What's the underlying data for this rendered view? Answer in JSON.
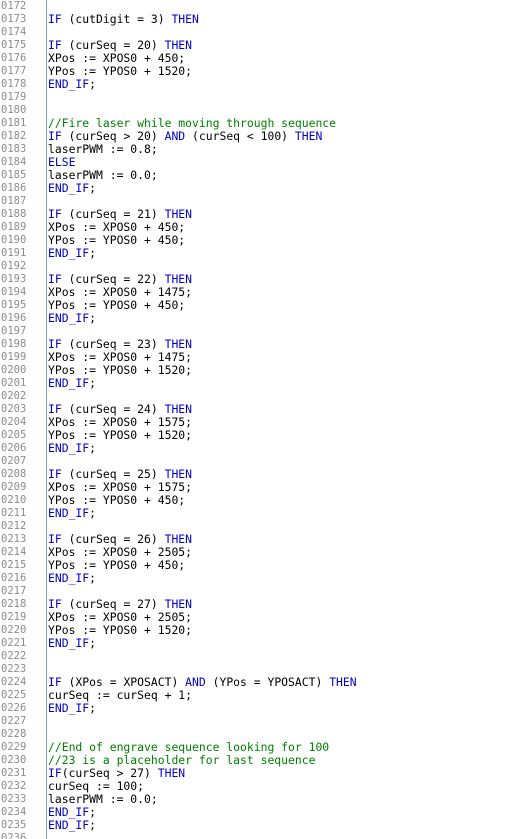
{
  "colors": {
    "keyword": "#0000c8",
    "comment": "#008000",
    "text": "#000000",
    "line_number": "#8c8c8c",
    "gutter_border": "#7f9db9"
  },
  "lines": [
    {
      "n": "0172",
      "t": [
        {
          "s": "",
          "c": "p"
        }
      ]
    },
    {
      "n": "0173",
      "t": [
        {
          "s": "IF",
          "c": "k"
        },
        {
          "s": " (cutDigit = 3) ",
          "c": "p"
        },
        {
          "s": "THEN",
          "c": "k"
        }
      ]
    },
    {
      "n": "0174",
      "t": [
        {
          "s": "",
          "c": "p"
        }
      ]
    },
    {
      "n": "0175",
      "t": [
        {
          "s": "IF",
          "c": "k"
        },
        {
          "s": " (curSeq = 20) ",
          "c": "p"
        },
        {
          "s": "THEN",
          "c": "k"
        }
      ]
    },
    {
      "n": "0176",
      "t": [
        {
          "s": "XPos := XPOS0 + 450;",
          "c": "p"
        }
      ]
    },
    {
      "n": "0177",
      "t": [
        {
          "s": "YPos := YPOS0 + 1520;",
          "c": "p"
        }
      ]
    },
    {
      "n": "0178",
      "t": [
        {
          "s": "END_IF",
          "c": "k"
        },
        {
          "s": ";",
          "c": "p"
        }
      ]
    },
    {
      "n": "0179",
      "t": [
        {
          "s": "",
          "c": "p"
        }
      ]
    },
    {
      "n": "0180",
      "t": [
        {
          "s": "",
          "c": "p"
        }
      ]
    },
    {
      "n": "0181",
      "t": [
        {
          "s": "//Fire laser while moving through sequence",
          "c": "c"
        }
      ]
    },
    {
      "n": "0182",
      "t": [
        {
          "s": "IF",
          "c": "k"
        },
        {
          "s": " (curSeq > 20) ",
          "c": "p"
        },
        {
          "s": "AND",
          "c": "k"
        },
        {
          "s": " (curSeq < 100) ",
          "c": "p"
        },
        {
          "s": "THEN",
          "c": "k"
        }
      ]
    },
    {
      "n": "0183",
      "t": [
        {
          "s": "laserPWM := 0.8;",
          "c": "p"
        }
      ]
    },
    {
      "n": "0184",
      "t": [
        {
          "s": "ELSE",
          "c": "k"
        }
      ]
    },
    {
      "n": "0185",
      "t": [
        {
          "s": "laserPWM := 0.0;",
          "c": "p"
        }
      ]
    },
    {
      "n": "0186",
      "t": [
        {
          "s": "END_IF",
          "c": "k"
        },
        {
          "s": ";",
          "c": "p"
        }
      ]
    },
    {
      "n": "0187",
      "t": [
        {
          "s": "",
          "c": "p"
        }
      ]
    },
    {
      "n": "0188",
      "t": [
        {
          "s": "IF",
          "c": "k"
        },
        {
          "s": " (curSeq = 21) ",
          "c": "p"
        },
        {
          "s": "THEN",
          "c": "k"
        }
      ]
    },
    {
      "n": "0189",
      "t": [
        {
          "s": "XPos := XPOS0 + 450;",
          "c": "p"
        }
      ]
    },
    {
      "n": "0190",
      "t": [
        {
          "s": "YPos := YPOS0 + 450;",
          "c": "p"
        }
      ]
    },
    {
      "n": "0191",
      "t": [
        {
          "s": "END_IF",
          "c": "k"
        },
        {
          "s": ";",
          "c": "p"
        }
      ]
    },
    {
      "n": "0192",
      "t": [
        {
          "s": "",
          "c": "p"
        }
      ]
    },
    {
      "n": "0193",
      "t": [
        {
          "s": "IF",
          "c": "k"
        },
        {
          "s": " (curSeq = 22) ",
          "c": "p"
        },
        {
          "s": "THEN",
          "c": "k"
        }
      ]
    },
    {
      "n": "0194",
      "t": [
        {
          "s": "XPos := XPOS0 + 1475;",
          "c": "p"
        }
      ]
    },
    {
      "n": "0195",
      "t": [
        {
          "s": "YPos := YPOS0 + 450;",
          "c": "p"
        }
      ]
    },
    {
      "n": "0196",
      "t": [
        {
          "s": "END_IF",
          "c": "k"
        },
        {
          "s": ";",
          "c": "p"
        }
      ]
    },
    {
      "n": "0197",
      "t": [
        {
          "s": "",
          "c": "p"
        }
      ]
    },
    {
      "n": "0198",
      "t": [
        {
          "s": "IF",
          "c": "k"
        },
        {
          "s": " (curSeq = 23) ",
          "c": "p"
        },
        {
          "s": "THEN",
          "c": "k"
        }
      ]
    },
    {
      "n": "0199",
      "t": [
        {
          "s": "XPos := XPOS0 + 1475;",
          "c": "p"
        }
      ]
    },
    {
      "n": "0200",
      "t": [
        {
          "s": "YPos := YPOS0 + 1520;",
          "c": "p"
        }
      ]
    },
    {
      "n": "0201",
      "t": [
        {
          "s": "END_IF",
          "c": "k"
        },
        {
          "s": ";",
          "c": "p"
        }
      ]
    },
    {
      "n": "0202",
      "t": [
        {
          "s": "",
          "c": "p"
        }
      ]
    },
    {
      "n": "0203",
      "t": [
        {
          "s": "IF",
          "c": "k"
        },
        {
          "s": " (curSeq = 24) ",
          "c": "p"
        },
        {
          "s": "THEN",
          "c": "k"
        }
      ]
    },
    {
      "n": "0204",
      "t": [
        {
          "s": "XPos := XPOS0 + 1575;",
          "c": "p"
        }
      ]
    },
    {
      "n": "0205",
      "t": [
        {
          "s": "YPos := YPOS0 + 1520;",
          "c": "p"
        }
      ]
    },
    {
      "n": "0206",
      "t": [
        {
          "s": "END_IF",
          "c": "k"
        },
        {
          "s": ";",
          "c": "p"
        }
      ]
    },
    {
      "n": "0207",
      "t": [
        {
          "s": "",
          "c": "p"
        }
      ]
    },
    {
      "n": "0208",
      "t": [
        {
          "s": "IF",
          "c": "k"
        },
        {
          "s": " (curSeq = 25) ",
          "c": "p"
        },
        {
          "s": "THEN",
          "c": "k"
        }
      ]
    },
    {
      "n": "0209",
      "t": [
        {
          "s": "XPos := XPOS0 + 1575;",
          "c": "p"
        }
      ]
    },
    {
      "n": "0210",
      "t": [
        {
          "s": "YPos := YPOS0 + 450;",
          "c": "p"
        }
      ]
    },
    {
      "n": "0211",
      "t": [
        {
          "s": "END_IF",
          "c": "k"
        },
        {
          "s": ";",
          "c": "p"
        }
      ]
    },
    {
      "n": "0212",
      "t": [
        {
          "s": "",
          "c": "p"
        }
      ]
    },
    {
      "n": "0213",
      "t": [
        {
          "s": "IF",
          "c": "k"
        },
        {
          "s": " (curSeq = 26) ",
          "c": "p"
        },
        {
          "s": "THEN",
          "c": "k"
        }
      ]
    },
    {
      "n": "0214",
      "t": [
        {
          "s": "XPos := XPOS0 + 2505;",
          "c": "p"
        }
      ]
    },
    {
      "n": "0215",
      "t": [
        {
          "s": "YPos := YPOS0 + 450;",
          "c": "p"
        }
      ]
    },
    {
      "n": "0216",
      "t": [
        {
          "s": "END_IF",
          "c": "k"
        },
        {
          "s": ";",
          "c": "p"
        }
      ]
    },
    {
      "n": "0217",
      "t": [
        {
          "s": "",
          "c": "p"
        }
      ]
    },
    {
      "n": "0218",
      "t": [
        {
          "s": "IF",
          "c": "k"
        },
        {
          "s": " (curSeq = 27) ",
          "c": "p"
        },
        {
          "s": "THEN",
          "c": "k"
        }
      ]
    },
    {
      "n": "0219",
      "t": [
        {
          "s": "XPos := XPOS0 + 2505;",
          "c": "p"
        }
      ]
    },
    {
      "n": "0220",
      "t": [
        {
          "s": "YPos := YPOS0 + 1520;",
          "c": "p"
        }
      ]
    },
    {
      "n": "0221",
      "t": [
        {
          "s": "END_IF",
          "c": "k"
        },
        {
          "s": ";",
          "c": "p"
        }
      ]
    },
    {
      "n": "0222",
      "t": [
        {
          "s": "",
          "c": "p"
        }
      ]
    },
    {
      "n": "0223",
      "t": [
        {
          "s": "",
          "c": "p"
        }
      ]
    },
    {
      "n": "0224",
      "t": [
        {
          "s": "IF",
          "c": "k"
        },
        {
          "s": " (XPos = XPOSACT) ",
          "c": "p"
        },
        {
          "s": "AND",
          "c": "k"
        },
        {
          "s": " (YPos = YPOSACT) ",
          "c": "p"
        },
        {
          "s": "THEN",
          "c": "k"
        }
      ]
    },
    {
      "n": "0225",
      "t": [
        {
          "s": "curSeq := curSeq + 1;",
          "c": "p"
        }
      ]
    },
    {
      "n": "0226",
      "t": [
        {
          "s": "END_IF",
          "c": "k"
        },
        {
          "s": ";",
          "c": "p"
        }
      ]
    },
    {
      "n": "0227",
      "t": [
        {
          "s": "",
          "c": "p"
        }
      ]
    },
    {
      "n": "0228",
      "t": [
        {
          "s": "",
          "c": "p"
        }
      ]
    },
    {
      "n": "0229",
      "t": [
        {
          "s": "//End of engrave sequence looking for 100",
          "c": "c"
        }
      ]
    },
    {
      "n": "0230",
      "t": [
        {
          "s": "//23 is a placeholder for last sequence",
          "c": "c"
        }
      ]
    },
    {
      "n": "0231",
      "t": [
        {
          "s": "IF",
          "c": "k"
        },
        {
          "s": "(curSeq > 27) ",
          "c": "p"
        },
        {
          "s": "THEN",
          "c": "k"
        }
      ]
    },
    {
      "n": "0232",
      "t": [
        {
          "s": "curSeq := 100;",
          "c": "p"
        }
      ]
    },
    {
      "n": "0233",
      "t": [
        {
          "s": "laserPWM := 0.0;",
          "c": "p"
        }
      ]
    },
    {
      "n": "0234",
      "t": [
        {
          "s": "END_IF",
          "c": "k"
        },
        {
          "s": ";",
          "c": "p"
        }
      ]
    },
    {
      "n": "0235",
      "t": [
        {
          "s": "END_IF",
          "c": "k"
        },
        {
          "s": ";",
          "c": "p"
        }
      ]
    },
    {
      "n": "0236",
      "t": [
        {
          "s": "",
          "c": "p"
        }
      ]
    }
  ]
}
